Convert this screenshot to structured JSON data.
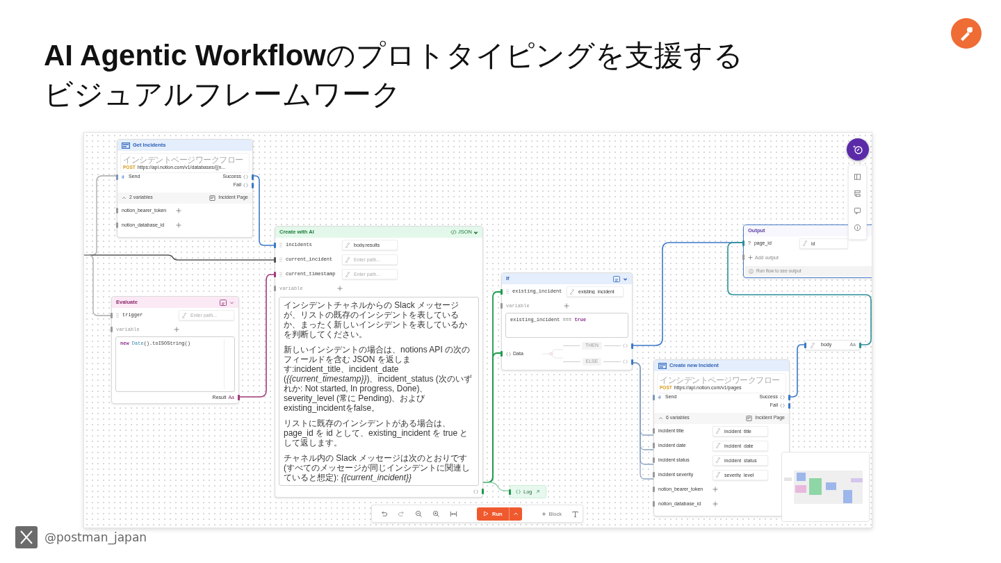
{
  "slide": {
    "title_lines": [
      "**AI Agentic Workflow**のプロトタイピングを支援する",
      "ビジュアルフレームワーク"
    ],
    "handle": "@postman_japan"
  },
  "http_requests": [
    {
      "title": "Get Incidents",
      "subtitle": "インシデントページワークフロー",
      "method": "POST",
      "url": "https://api.notion.com/v1/databases/{{n...",
      "send": "Send",
      "outputs": [
        "Success",
        "Fail"
      ],
      "variables_toggle": "2 variables",
      "expanded": true,
      "collection": "Incident Page",
      "variables": [
        {
          "name": "notion_bearer_token"
        },
        {
          "name": "notion_database_id"
        }
      ]
    },
    {
      "title": "Create new Incident",
      "subtitle": "インシデントページワークフロー",
      "method": "POST",
      "url": "https://api.notion.com/v1/pages",
      "send": "Send",
      "outputs": [
        "Success",
        "Fail"
      ],
      "variables_toggle": "6 variables",
      "expanded": true,
      "collection": "Incident Page",
      "variables": [
        {
          "name": "incident title",
          "value": "incident_title"
        },
        {
          "name": "incident date",
          "value": "incident_date"
        },
        {
          "name": "incident status",
          "value": "incident_status"
        },
        {
          "name": "incident severity",
          "value": "severity_level"
        },
        {
          "name": "notion_bearer_token"
        },
        {
          "name": "notion_database_id"
        }
      ]
    }
  ],
  "create_with_ai": {
    "title": "Create with AI",
    "format": "JSON",
    "inputs": [
      {
        "name": "incidents",
        "value": "body.results"
      },
      {
        "name": "current_incident",
        "placeholder": "Enter path..."
      },
      {
        "name": "current_timestamp",
        "placeholder": "Enter path..."
      }
    ],
    "add_variable": "variable",
    "prompt": [
      "インシデントチャネルからの Slack メッセージが、リストの既存のインシデントを表しているか、まったく新しいインシデントを表しているかを判断してください。",
      "新しいインシデントの場合は、notions API の次のフィールドを含む JSON を返します:incident_title、incident_date (*{{current_timestamp}}*)、incident_status (次のいずれか: Not started, In progress, Done)、severity_level (常に Pending)、および existing_incidentをfalse。",
      "リストに既存のインシデントがある場合は、page_id を id として、existing_incident を true として返します。",
      "チャネル内の Slack メッセージは次のとおりです (すべてのメッセージが同じインシデントに関連していると想定): *{{current_incident}}*"
    ]
  },
  "evaluate": {
    "title": "Evaluate",
    "inputs": [
      {
        "name": "trigger",
        "placeholder": "Enter path..."
      }
    ],
    "add_variable": "variable",
    "code": [
      {
        "kind": "keyword",
        "text": "new"
      },
      {
        "kind": "type",
        "text": " Date"
      },
      {
        "kind": "plain",
        "text": "().toISOString()"
      }
    ],
    "result_label": "Result",
    "result_type": "Aa"
  },
  "if_block": {
    "title": "If",
    "inputs": [
      {
        "name": "existing_incident",
        "value": "existing_incident"
      }
    ],
    "add_variable": "variable",
    "condition": [
      {
        "kind": "plain",
        "text": "existing_incident === "
      },
      {
        "kind": "keyword",
        "text": "true"
      }
    ],
    "data_label": "Data",
    "branches": [
      "THEN",
      "ELSE"
    ]
  },
  "output": {
    "title": "Output",
    "fields": [
      {
        "marker": "?",
        "name": "page_id",
        "value": "id"
      }
    ],
    "add_output": "Add output",
    "hint": "Run flow to see output"
  },
  "body_port": {
    "label": "body",
    "type": "Aa"
  },
  "log": {
    "label": "Log"
  },
  "toolbar": {
    "run": "Run",
    "add_block": "Block"
  }
}
